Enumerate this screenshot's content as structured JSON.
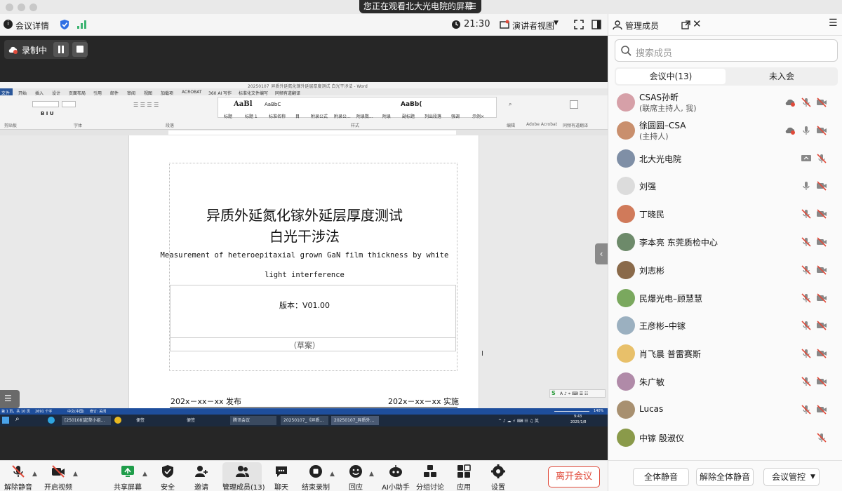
{
  "share_banner": {
    "text": "您正在观看北大光电院的屏幕"
  },
  "infobar": {
    "meeting_details": "会议详情",
    "time": "21:30",
    "presenter_view": "演讲者视图"
  },
  "recording": {
    "label": "录制中"
  },
  "word": {
    "window_title": "20250107_异质外延氮化镓外延层厚度测试 白光干涉法 - Word",
    "tabs": [
      "文件",
      "开始",
      "插入",
      "设计",
      "页面布局",
      "引用",
      "邮件",
      "审阅",
      "视图",
      "加载项",
      "ACROBAT",
      "360 AI 写作",
      "标准化文件编写",
      "同频有道翻译"
    ],
    "styles": [
      "标题",
      "标题 1",
      "标准名称",
      "目",
      "附录公式",
      "附录公...",
      "附录数...",
      "附录",
      "副标题",
      "列出段落",
      "强调",
      "示例×"
    ],
    "group_labels": [
      "剪贴板",
      "字体",
      "段落",
      "样式",
      "编辑",
      "Adobe Acrobat",
      "同频有道翻译"
    ],
    "doc": {
      "title_line1": "异质外延氮化镓外延层厚度测试",
      "title_line2": "白光干涉法",
      "en_title_line1": "Measurement of heteroepitaxial grown GaN film thickness by white",
      "en_title_line2": "light interference",
      "version": "版本：V01.00",
      "draft": "（草案）",
      "publish": "202x－xx－xx 发布",
      "implement": "202x－xx－xx 实施"
    },
    "status": {
      "page": "第 1 页，共 10 页",
      "words": "2691 个字",
      "lang": "中文(中国)",
      "revise": "修订: 关闭",
      "zoom": "140%"
    },
    "taskbar": {
      "items": [
        "[250108]起草小组...",
        "便签",
        "便签",
        "腾讯会议",
        "20250107_《异质...",
        "20250107_异质外..."
      ],
      "time": "9:43",
      "date": "2025/1/8"
    }
  },
  "toolbar": {
    "unmute": "解除静音",
    "video": "开启视频",
    "share": "共享屏幕",
    "security": "安全",
    "invite": "邀请",
    "members": "管理成员(13)",
    "chat": "聊天",
    "stop_record": "结束录制",
    "react": "回应",
    "ai": "AI小助手",
    "breakout": "分组讨论",
    "apps": "应用",
    "settings": "设置",
    "leave": "离开会议"
  },
  "panel": {
    "title": "管理成员",
    "search_placeholder": "搜索成员",
    "tab_in": "会议中(13)",
    "tab_out": "未入会",
    "members": [
      {
        "name": "CSAS孙昕",
        "sub": "(联席主持人, 我)",
        "avatar": "#d6a0a8"
      },
      {
        "name": "徐圆圆–CSA",
        "sub": "(主持人)",
        "avatar": "#c98f6d"
      },
      {
        "name": "北大光电院",
        "sub": "",
        "avatar": "#7f8fa6"
      },
      {
        "name": "刘强",
        "sub": "",
        "avatar": "#dcdcdc"
      },
      {
        "name": "丁晓民",
        "sub": "",
        "avatar": "#d07a5a"
      },
      {
        "name": "李本亮 东莞质检中心",
        "sub": "",
        "avatar": "#6d8a6a"
      },
      {
        "name": "刘志彬",
        "sub": "",
        "avatar": "#8a6a4a"
      },
      {
        "name": "民爆光电–顾慧慧",
        "sub": "",
        "avatar": "#7aa85e"
      },
      {
        "name": "王彦彬–中镓",
        "sub": "",
        "avatar": "#9bb0c0"
      },
      {
        "name": "肖飞晨 普雷赛斯",
        "sub": "",
        "avatar": "#e8c06a"
      },
      {
        "name": "朱广敏",
        "sub": "",
        "avatar": "#b08aa8"
      },
      {
        "name": "Lucas",
        "sub": "",
        "avatar": "#a89070"
      },
      {
        "name": "中镓 殷淑仪",
        "sub": "",
        "avatar": "#8a9a4a"
      }
    ],
    "mute_all": "全体静音",
    "unmute_all": "解除全体静音",
    "control": "会议管控"
  }
}
